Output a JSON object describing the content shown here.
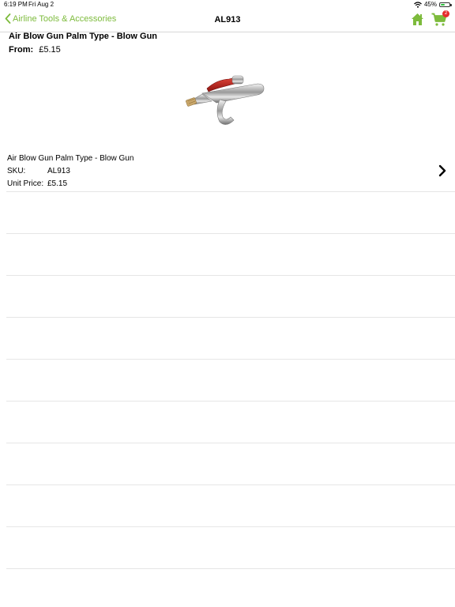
{
  "status": {
    "time": "6:19 PM",
    "date": "Fri Aug 2",
    "battery": "45%",
    "battery_level": 0.45
  },
  "nav": {
    "back_label": "Airline Tools & Accessories",
    "title": "AL913",
    "cart_count": "2",
    "accent": "#7dbb3c"
  },
  "product": {
    "title": "Air Blow Gun Palm Type - Blow Gun",
    "from_label": "From:",
    "from_price": "£5.15"
  },
  "variant": {
    "name": "Air Blow Gun Palm Type - Blow Gun",
    "sku_label": "SKU:",
    "sku": "AL913",
    "price_label": "Unit Price:",
    "price": "£5.15"
  }
}
